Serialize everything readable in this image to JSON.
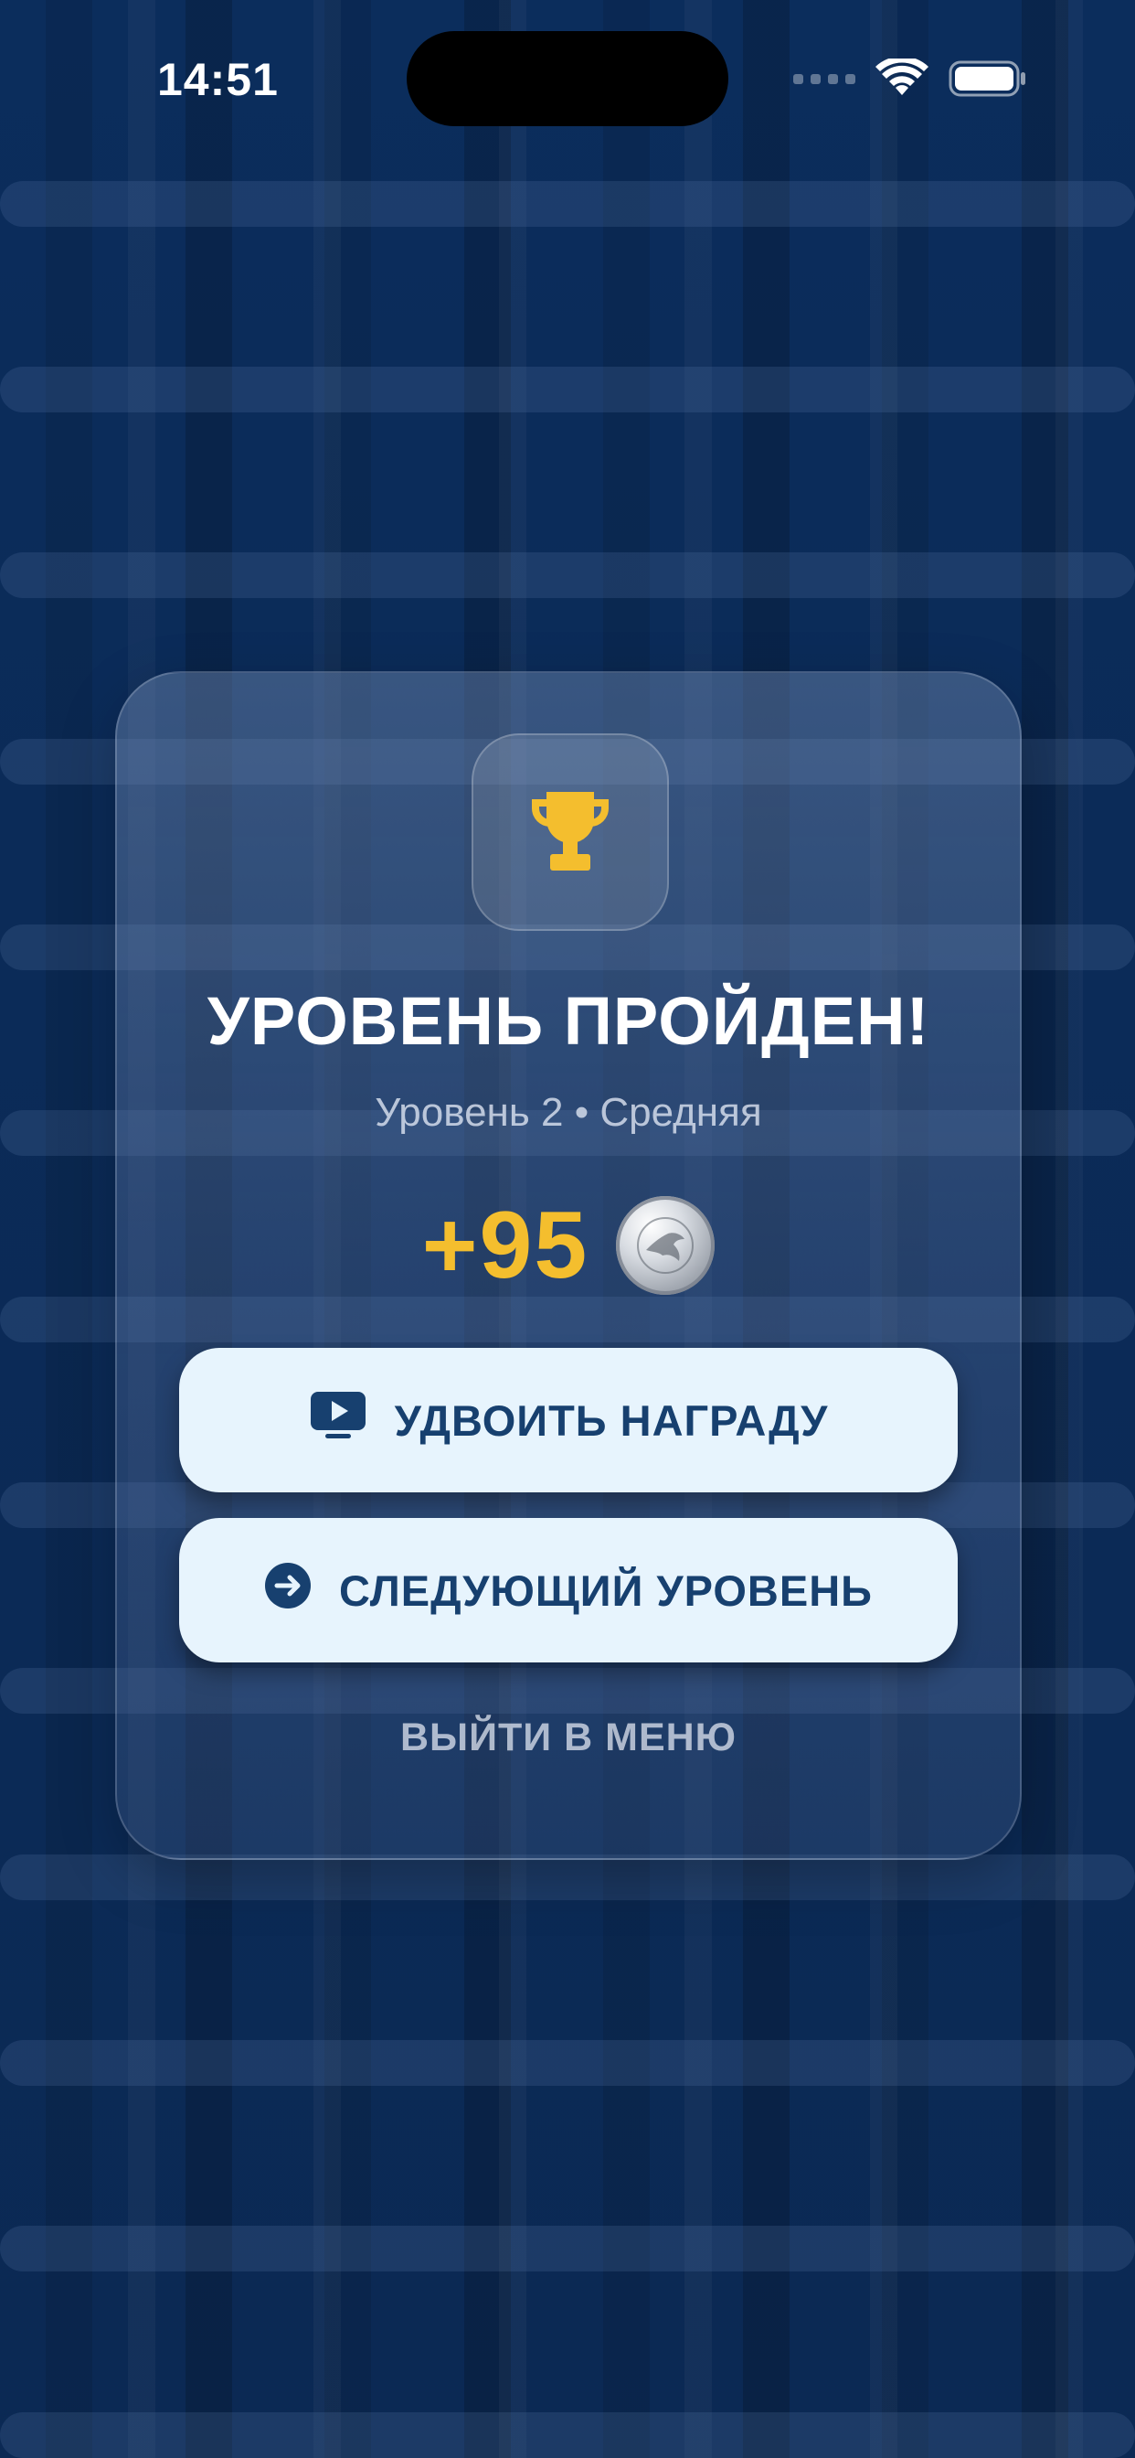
{
  "status_bar": {
    "time": "14:51"
  },
  "dialog": {
    "title": "УРОВЕНЬ ПРОЙДЕН!",
    "subtitle": "Уровень 2 • Средняя",
    "reward": {
      "amount": "+95",
      "currency_icon": "silver-coin-icon"
    },
    "buttons": {
      "double_reward": {
        "label": "УДВОИТЬ НАГРАДУ",
        "icon": "play-tv-icon"
      },
      "next_level": {
        "label": "СЛЕДУЮЩИЙ УРОВЕНЬ",
        "icon": "arrow-right-circle-icon"
      },
      "exit": {
        "label": "ВЫЙТИ В МЕНЮ"
      }
    },
    "header_icon": "trophy-icon"
  },
  "colors": {
    "background": "#0b2b58",
    "accent_gold": "#f4be2e",
    "button_bg": "#e7f4fd",
    "button_text": "#17406f",
    "title_text": "#ffffff"
  }
}
